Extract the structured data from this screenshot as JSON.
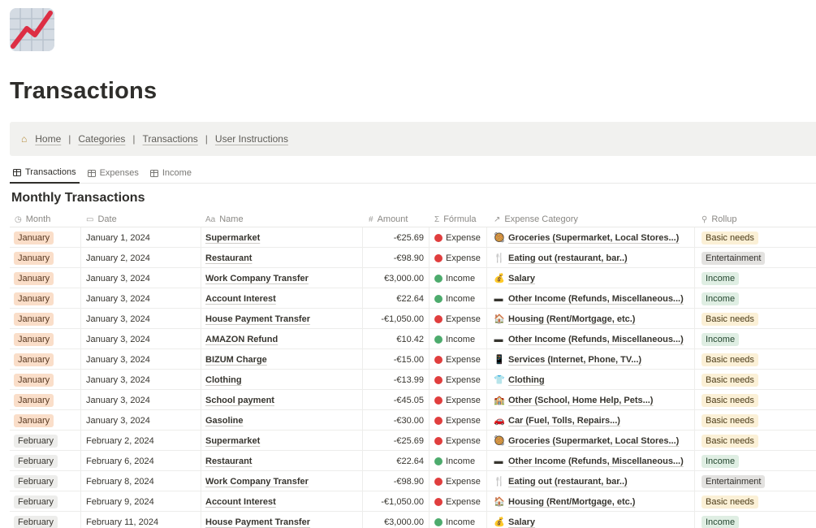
{
  "page": {
    "title": "Transactions",
    "icon": "chart-increasing-icon"
  },
  "nav": {
    "home_icon": "house-icon",
    "links": [
      "Home",
      "Categories",
      "Transactions",
      "User Instructions"
    ],
    "separator": "|"
  },
  "views": {
    "tabs": [
      {
        "label": "Transactions",
        "active": true
      },
      {
        "label": "Expenses",
        "active": false
      },
      {
        "label": "Income",
        "active": false
      }
    ]
  },
  "database": {
    "title": "Monthly Transactions",
    "columns": [
      {
        "label": "Month",
        "icon": "◷"
      },
      {
        "label": "Date",
        "icon": "▭"
      },
      {
        "label": "Name",
        "icon": "Aa"
      },
      {
        "label": "Amount",
        "icon": "#"
      },
      {
        "label": "Fórmula",
        "icon": "Σ"
      },
      {
        "label": "Expense Category",
        "icon": "↗"
      },
      {
        "label": "Rollup",
        "icon": "⚲"
      }
    ],
    "rows": [
      {
        "month": "January",
        "date": "January 1, 2024",
        "name": "Supermarket",
        "amount": "-€25.69",
        "formula": "Expense",
        "category": "Groceries (Supermarket, Local Stores...)",
        "cat_icon": "🥘",
        "rollup": "Basic needs"
      },
      {
        "month": "January",
        "date": "January 2, 2024",
        "name": "Restaurant",
        "amount": "-€98.90",
        "formula": "Expense",
        "category": "Eating out (restaurant, bar..)",
        "cat_icon": "🍴",
        "rollup": "Entertainment"
      },
      {
        "month": "January",
        "date": "January 3, 2024",
        "name": "Work Company Transfer",
        "amount": "€3,000.00",
        "formula": "Income",
        "category": "Salary",
        "cat_icon": "💰",
        "rollup": "Income"
      },
      {
        "month": "January",
        "date": "January 3, 2024",
        "name": "Account Interest",
        "amount": "€22.64",
        "formula": "Income",
        "category": "Other Income (Refunds, Miscellaneous...)",
        "cat_icon": "▬",
        "rollup": "Income"
      },
      {
        "month": "January",
        "date": "January 3, 2024",
        "name": "House Payment Transfer",
        "amount": "-€1,050.00",
        "formula": "Expense",
        "category": "Housing (Rent/Mortgage, etc.)",
        "cat_icon": "🏠",
        "rollup": "Basic needs"
      },
      {
        "month": "January",
        "date": "January 3, 2024",
        "name": "AMAZON Refund",
        "amount": "€10.42",
        "formula": "Income",
        "category": "Other Income (Refunds, Miscellaneous...)",
        "cat_icon": "▬",
        "rollup": "Income"
      },
      {
        "month": "January",
        "date": "January 3, 2024",
        "name": "BIZUM Charge",
        "amount": "-€15.00",
        "formula": "Expense",
        "category": "Services (Internet, Phone, TV...)",
        "cat_icon": "📱",
        "rollup": "Basic needs"
      },
      {
        "month": "January",
        "date": "January 3, 2024",
        "name": "Clothing",
        "amount": "-€13.99",
        "formula": "Expense",
        "category": "Clothing",
        "cat_icon": "👕",
        "rollup": "Basic needs"
      },
      {
        "month": "January",
        "date": "January 3, 2024",
        "name": "School payment",
        "amount": "-€45.05",
        "formula": "Expense",
        "category": "Other (School, Home Help, Pets...)",
        "cat_icon": "🏫",
        "rollup": "Basic needs"
      },
      {
        "month": "January",
        "date": "January 3, 2024",
        "name": "Gasoline",
        "amount": "-€30.00",
        "formula": "Expense",
        "category": "Car (Fuel, Tolls, Repairs...)",
        "cat_icon": "🚗",
        "rollup": "Basic needs"
      },
      {
        "month": "February",
        "date": "February 2, 2024",
        "name": "Supermarket",
        "amount": "-€25.69",
        "formula": "Expense",
        "category": "Groceries (Supermarket, Local Stores...)",
        "cat_icon": "🥘",
        "rollup": "Basic needs"
      },
      {
        "month": "February",
        "date": "February 6, 2024",
        "name": "Restaurant",
        "amount": "€22.64",
        "formula": "Income",
        "category": "Other Income (Refunds, Miscellaneous...)",
        "cat_icon": "▬",
        "rollup": "Income"
      },
      {
        "month": "February",
        "date": "February 8, 2024",
        "name": "Work Company Transfer",
        "amount": "-€98.90",
        "formula": "Expense",
        "category": "Eating out (restaurant, bar..)",
        "cat_icon": "🍴",
        "rollup": "Entertainment"
      },
      {
        "month": "February",
        "date": "February 9, 2024",
        "name": "Account Interest",
        "amount": "-€1,050.00",
        "formula": "Expense",
        "category": "Housing (Rent/Mortgage, etc.)",
        "cat_icon": "🏠",
        "rollup": "Basic needs"
      },
      {
        "month": "February",
        "date": "February 11, 2024",
        "name": "House Payment Transfer",
        "amount": "€3,000.00",
        "formula": "Income",
        "category": "Salary",
        "cat_icon": "💰",
        "rollup": "Income"
      }
    ]
  },
  "colors": {
    "expense_dot": "#e03e3e",
    "income_dot": "#4dab6d",
    "january_tag": "#fadec9",
    "february_tag": "#ededeb",
    "basic_needs_tag": "#fbf0d6",
    "entertainment_tag": "#e3e2e0",
    "income_tag": "#dfeee3",
    "chart_line": "#dd2e44"
  }
}
